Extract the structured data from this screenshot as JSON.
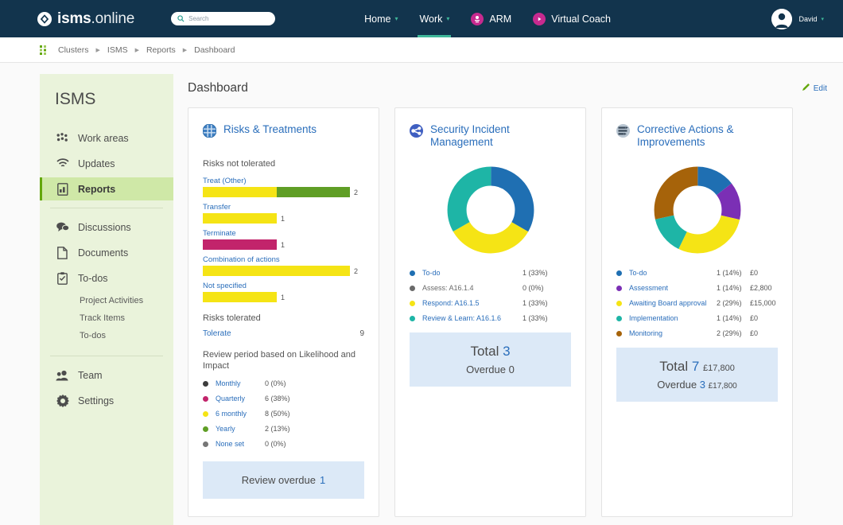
{
  "topbar": {
    "brand_bold": "isms",
    "brand_light": ".online",
    "brand_icon": "isms-diamond-logo",
    "search": {
      "placeholder": "Search",
      "icon": "search-icon"
    },
    "nav": [
      {
        "label": "Home",
        "caret": "▾",
        "active": false,
        "icon": null
      },
      {
        "label": "Work",
        "caret": "▾",
        "active": true,
        "icon": null
      },
      {
        "label": "ARM",
        "caret": "",
        "active": false,
        "icon": "arm-badge-icon"
      },
      {
        "label": "Virtual Coach",
        "caret": "",
        "active": false,
        "icon": "play-circle-icon"
      }
    ],
    "user": {
      "name": "David",
      "caret": "▾",
      "icon": "avatar-icon"
    },
    "bg_color": "#12344d",
    "accent_color": "#3fb89a",
    "pill_color": "#c72a8f"
  },
  "breadcrumb": {
    "icon": "clusters-grid-icon",
    "separator": "▶",
    "items": [
      "Clusters",
      "ISMS",
      "Reports",
      "Dashboard"
    ]
  },
  "sidebar": {
    "title": "ISMS",
    "items": [
      {
        "label": "Work areas",
        "icon": "work-areas-icon",
        "selected": false
      },
      {
        "label": "Updates",
        "icon": "updates-wifi-icon",
        "selected": false
      },
      {
        "label": "Reports",
        "icon": "reports-doc-icon",
        "selected": true
      }
    ],
    "items2": [
      {
        "label": "Discussions",
        "icon": "discussions-bubbles-icon",
        "selected": false
      },
      {
        "label": "Documents",
        "icon": "documents-page-icon",
        "selected": false
      },
      {
        "label": "To-dos",
        "icon": "todos-clipboard-icon",
        "selected": false
      }
    ],
    "subitems": [
      "Project Activities",
      "Track Items",
      "To-dos"
    ],
    "items3": [
      {
        "label": "Team",
        "icon": "team-people-icon",
        "selected": false
      },
      {
        "label": "Settings",
        "icon": "settings-gear-icon",
        "selected": false
      }
    ],
    "bg_color": "#eaf3db",
    "selected_color": "#cfe8a7"
  },
  "content": {
    "page_title": "Dashboard",
    "edit_label": "Edit",
    "edit_icon": "pencil-icon"
  },
  "chart_data": [
    {
      "type": "bar",
      "title": "Risks & Treatments",
      "icon": "globe-grid-icon",
      "section_label": "Risks not tolerated",
      "xlabel": "",
      "ylabel": "",
      "max_value": 2,
      "categories": [
        "Treat (Other)",
        "Transfer",
        "Terminate",
        "Combination of actions",
        "Not specified"
      ],
      "values": [
        2,
        1,
        1,
        2,
        1
      ],
      "bars": [
        {
          "name": "Treat (Other)",
          "value": 2,
          "segments": [
            {
              "value": 1,
              "color": "#f5e415"
            },
            {
              "value": 1,
              "color": "#5f9e25"
            }
          ]
        },
        {
          "name": "Transfer",
          "value": 1,
          "segments": [
            {
              "value": 1,
              "color": "#f5e415"
            }
          ]
        },
        {
          "name": "Terminate",
          "value": 1,
          "segments": [
            {
              "value": 1,
              "color": "#c2246b"
            }
          ]
        },
        {
          "name": "Combination of actions",
          "value": 2,
          "segments": [
            {
              "value": 2,
              "color": "#f5e415"
            }
          ]
        },
        {
          "name": "Not specified",
          "value": 1,
          "segments": [
            {
              "value": 1,
              "color": "#f5e415"
            }
          ]
        }
      ],
      "tolerated_label": "Risks tolerated",
      "tolerate_name": "Tolerate",
      "tolerate_value": "9",
      "review_section_label": "Review period based on Likelihood and Impact",
      "review_legend": [
        {
          "label": "Monthly",
          "count": "0 (0%)",
          "color": "#3d3d3d",
          "value": 0,
          "percent": 0
        },
        {
          "label": "Quarterly",
          "count": "6 (38%)",
          "color": "#c2246b",
          "value": 6,
          "percent": 38
        },
        {
          "label": "6 monthly",
          "count": "8 (50%)",
          "color": "#f5e415",
          "value": 8,
          "percent": 50
        },
        {
          "label": "Yearly",
          "count": "2 (13%)",
          "color": "#5f9e25",
          "value": 2,
          "percent": 13
        },
        {
          "label": "None set",
          "count": "0 (0%)",
          "color": "#767676",
          "value": 0,
          "percent": 0
        }
      ],
      "review_overdue_label": "Review overdue",
      "review_overdue_value": "1"
    },
    {
      "type": "pie",
      "title": "Security Incident Management",
      "icon": "incident-node-icon",
      "labels": [
        "To-do",
        "Assess: A16.1.4",
        "Respond: A16.1.5",
        "Review & Learn: A16.1.6"
      ],
      "values": [
        1,
        0,
        1,
        1
      ],
      "percents": [
        33,
        0,
        33,
        33
      ],
      "colors": [
        "#1f6fb2",
        "#6a6a6a",
        "#f5e415",
        "#1eb5a6"
      ],
      "legend_position": "bottom",
      "legend": [
        {
          "label": "To-do",
          "count": "1 (33%)",
          "color": "#1f6fb2",
          "link": true
        },
        {
          "label": "Assess: A16.1.4",
          "count": "0 (0%)",
          "color": "#6a6a6a",
          "link": false
        },
        {
          "label": "Respond: A16.1.5",
          "count": "1 (33%)",
          "color": "#f5e415",
          "link": true
        },
        {
          "label": "Review & Learn: A16.1.6",
          "count": "1 (33%)",
          "color": "#1eb5a6",
          "link": true
        }
      ],
      "total_label": "Total",
      "total_value": "3",
      "overdue_label": "Overdue",
      "overdue_value": "0"
    },
    {
      "type": "pie",
      "title": "Corrective Actions & Improvements",
      "icon": "corrective-actions-icon",
      "labels": [
        "To-do",
        "Assessment",
        "Awaiting Board approval",
        "Implementation",
        "Monitoring"
      ],
      "values": [
        1,
        1,
        2,
        1,
        2
      ],
      "percents": [
        14,
        14,
        29,
        14,
        29
      ],
      "colors": [
        "#1f6fb2",
        "#7b2fb5",
        "#f5e415",
        "#1eb5a6",
        "#a6630a"
      ],
      "legend_position": "bottom",
      "legend": [
        {
          "label": "To-do",
          "count": "1 (14%)",
          "amount": "£0",
          "color": "#1f6fb2",
          "link": true
        },
        {
          "label": "Assessment",
          "count": "1 (14%)",
          "amount": "£2,800",
          "color": "#7b2fb5",
          "link": true
        },
        {
          "label": "Awaiting Board approval",
          "count": "2 (29%)",
          "amount": "£15,000",
          "color": "#f5e415",
          "link": true
        },
        {
          "label": "Implementation",
          "count": "1 (14%)",
          "amount": "£0",
          "color": "#1eb5a6",
          "link": true
        },
        {
          "label": "Monitoring",
          "count": "2 (29%)",
          "amount": "£0",
          "color": "#a6630a",
          "link": true
        }
      ],
      "total_label": "Total",
      "total_value": "7",
      "total_amount": "£17,800",
      "overdue_label": "Overdue",
      "overdue_value": "3",
      "overdue_amount": "£17,800"
    }
  ]
}
